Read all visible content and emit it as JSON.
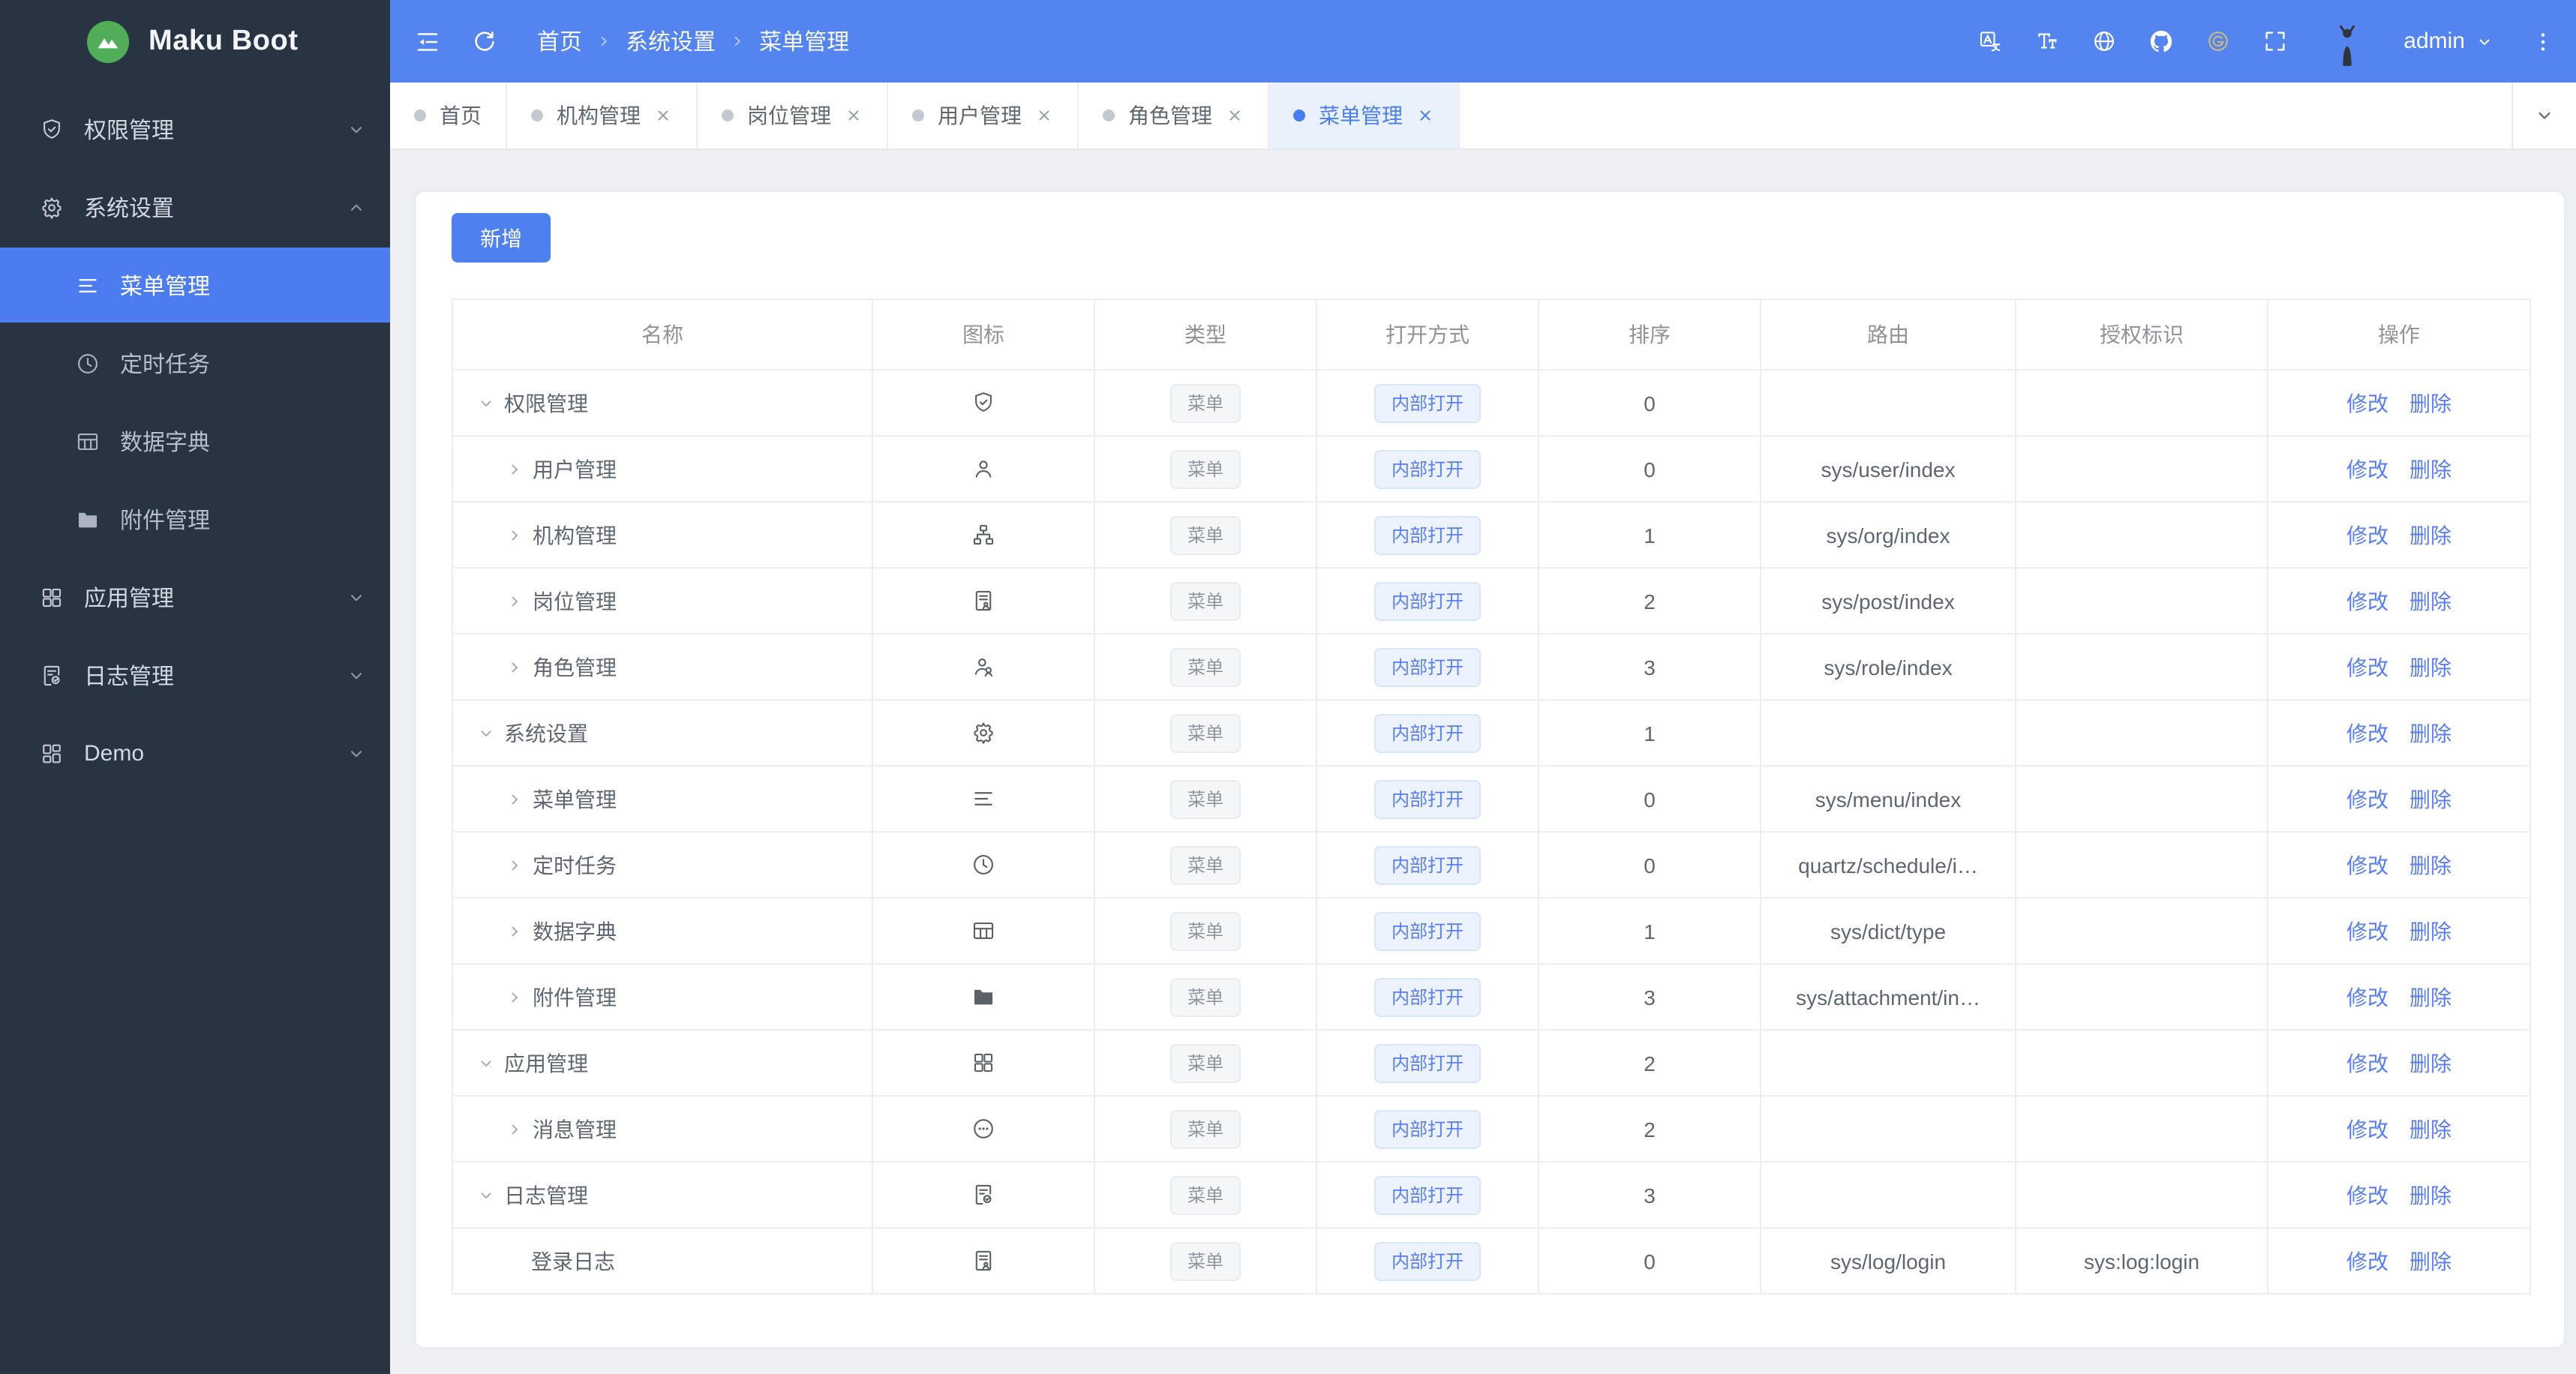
{
  "app": {
    "name": "Maku Boot"
  },
  "colors": {
    "header_blue": "#5384f0",
    "accent_blue": "#4f80f0",
    "link_blue": "#587df6",
    "sidebar_bg": "#293443",
    "active_item_bg": "#4c7cf0",
    "page_bg": "#eef0f4",
    "gitee_gold": "#c9b77f"
  },
  "sidebar": {
    "logo_text": "Maku Boot",
    "items": [
      {
        "key": "auth",
        "icon": "shield-check",
        "label": "权限管理",
        "type": "group",
        "chevron": "down"
      },
      {
        "key": "system",
        "icon": "gear",
        "label": "系统设置",
        "type": "group",
        "chevron": "up"
      },
      {
        "key": "menu",
        "icon": "menu-lines",
        "label": "菜单管理",
        "type": "child",
        "active": true
      },
      {
        "key": "schedule",
        "icon": "clock",
        "label": "定时任务",
        "type": "child"
      },
      {
        "key": "dict",
        "icon": "table-grid",
        "label": "数据字典",
        "type": "child"
      },
      {
        "key": "attachment",
        "icon": "folder",
        "label": "附件管理",
        "type": "child"
      },
      {
        "key": "app",
        "icon": "grid",
        "label": "应用管理",
        "type": "group",
        "chevron": "down"
      },
      {
        "key": "log",
        "icon": "doc-check",
        "label": "日志管理",
        "type": "group",
        "chevron": "down"
      },
      {
        "key": "demo",
        "icon": "grid-variant",
        "label": "Demo",
        "type": "group",
        "chevron": "down"
      }
    ]
  },
  "topbar": {
    "breadcrumb": [
      "首页",
      "系统设置",
      "菜单管理"
    ],
    "actions": [
      {
        "key": "translate",
        "icon": "translate"
      },
      {
        "key": "font-size",
        "icon": "font-size"
      },
      {
        "key": "language",
        "icon": "globe"
      },
      {
        "key": "github",
        "icon": "github"
      },
      {
        "key": "gitee",
        "icon": "gitee",
        "color": "#c9b77f"
      },
      {
        "key": "fullscreen",
        "icon": "fullscreen"
      }
    ],
    "user_name": "admin"
  },
  "tabbar": {
    "tabs": [
      {
        "label": "首页",
        "closable": false,
        "active": false
      },
      {
        "label": "机构管理",
        "closable": true,
        "active": false
      },
      {
        "label": "岗位管理",
        "closable": true,
        "active": false
      },
      {
        "label": "用户管理",
        "closable": true,
        "active": false
      },
      {
        "label": "角色管理",
        "closable": true,
        "active": false
      },
      {
        "label": "菜单管理",
        "closable": true,
        "active": true
      }
    ]
  },
  "toolbar": {
    "add_label": "新增"
  },
  "table": {
    "columns": [
      "名称",
      "图标",
      "类型",
      "打开方式",
      "排序",
      "路由",
      "授权标识",
      "操作"
    ],
    "type_tag": "菜单",
    "open_tag": "内部打开",
    "ops": [
      "修改",
      "删除"
    ],
    "rows": [
      {
        "name": "权限管理",
        "icon": "shield-check",
        "level": 0,
        "arrow": "down",
        "sort": "0",
        "route": "",
        "auth": ""
      },
      {
        "name": "用户管理",
        "icon": "user",
        "level": 1,
        "arrow": "right",
        "sort": "0",
        "route": "sys/user/index",
        "auth": ""
      },
      {
        "name": "机构管理",
        "icon": "org-tree",
        "level": 1,
        "arrow": "right",
        "sort": "1",
        "route": "sys/org/index",
        "auth": ""
      },
      {
        "name": "岗位管理",
        "icon": "id-card",
        "level": 1,
        "arrow": "right",
        "sort": "2",
        "route": "sys/post/index",
        "auth": ""
      },
      {
        "name": "角色管理",
        "icon": "user-group",
        "level": 1,
        "arrow": "right",
        "sort": "3",
        "route": "sys/role/index",
        "auth": ""
      },
      {
        "name": "系统设置",
        "icon": "gear",
        "level": 0,
        "arrow": "down",
        "sort": "1",
        "route": "",
        "auth": ""
      },
      {
        "name": "菜单管理",
        "icon": "menu-lines",
        "level": 1,
        "arrow": "right",
        "sort": "0",
        "route": "sys/menu/index",
        "auth": ""
      },
      {
        "name": "定时任务",
        "icon": "clock",
        "level": 1,
        "arrow": "right",
        "sort": "0",
        "route": "quartz/schedule/i…",
        "auth": ""
      },
      {
        "name": "数据字典",
        "icon": "table-grid",
        "level": 1,
        "arrow": "right",
        "sort": "1",
        "route": "sys/dict/type",
        "auth": ""
      },
      {
        "name": "附件管理",
        "icon": "folder",
        "level": 1,
        "arrow": "right",
        "sort": "3",
        "route": "sys/attachment/in…",
        "auth": ""
      },
      {
        "name": "应用管理",
        "icon": "grid",
        "level": 0,
        "arrow": "down",
        "sort": "2",
        "route": "",
        "auth": ""
      },
      {
        "name": "消息管理",
        "icon": "chat-dots",
        "level": 1,
        "arrow": "right",
        "sort": "2",
        "route": "",
        "auth": ""
      },
      {
        "name": "日志管理",
        "icon": "doc-check",
        "level": 0,
        "arrow": "down",
        "sort": "3",
        "route": "",
        "auth": ""
      },
      {
        "name": "登录日志",
        "icon": "id-card",
        "level": 2,
        "arrow": "none",
        "sort": "0",
        "route": "sys/log/login",
        "auth": "sys:log:login"
      }
    ]
  }
}
